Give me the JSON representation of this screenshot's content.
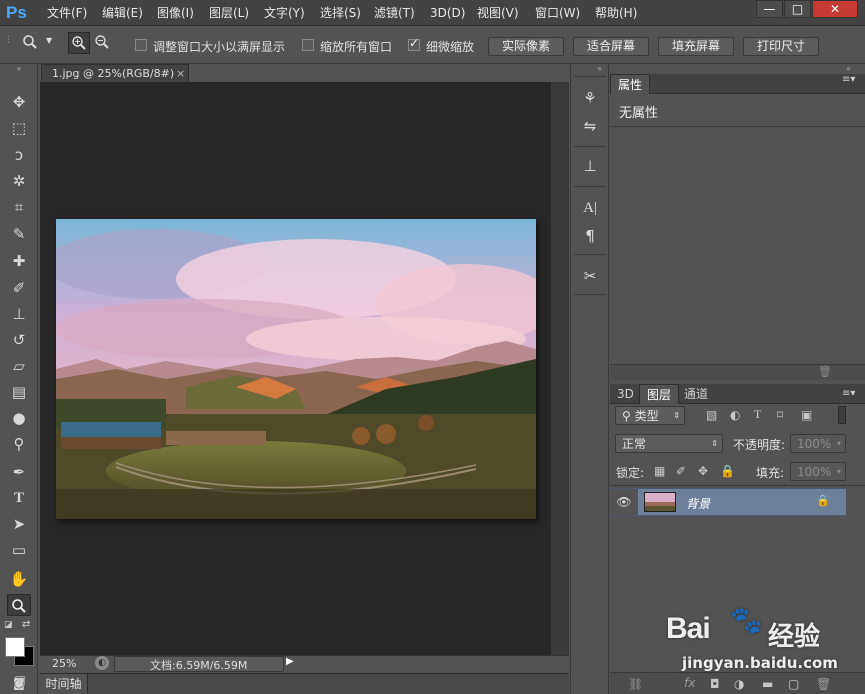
{
  "app": {
    "logo": "Ps"
  },
  "menu": [
    "文件(F)",
    "编辑(E)",
    "图像(I)",
    "图层(L)",
    "文字(Y)",
    "选择(S)",
    "滤镜(T)",
    "3D(D)",
    "视图(V)",
    "窗口(W)",
    "帮助(H)"
  ],
  "window_controls": {
    "minimize": "—",
    "restore": "□",
    "close": "✕"
  },
  "options": {
    "resize_windows_label": "调整窗口大小以满屏显示",
    "resize_windows_checked": false,
    "zoom_all_label": "缩放所有窗口",
    "zoom_all_checked": false,
    "scrubby_zoom_label": "细微缩放",
    "scrubby_zoom_checked": true,
    "actual_pixels_button": "实际像素",
    "fit_screen_button": "适合屏幕",
    "fill_screen_button": "填充屏幕",
    "print_size_button": "打印尺寸"
  },
  "document": {
    "tab_title": "1.jpg @ 25%(RGB/8#)",
    "tab_close": "×",
    "zoom": "25%",
    "doc_size": "文档:6.59M/6.59M"
  },
  "timeline": {
    "label": "时间轴"
  },
  "properties": {
    "tab": "属性",
    "content": "无属性"
  },
  "layers": {
    "tabs": [
      "3D",
      "图层",
      "通道"
    ],
    "filter_kind": "类型",
    "blend_mode": "正常",
    "opacity_label": "不透明度:",
    "opacity_value": "100%",
    "lock_label": "锁定:",
    "fill_label": "填充:",
    "fill_value": "100%",
    "rows": [
      {
        "name": "背景",
        "visible": true,
        "locked": true
      }
    ]
  },
  "watermark": {
    "brand": "Bai",
    "brand_suffix": "经验",
    "url": "jingyan.baidu.com"
  },
  "colors": {
    "accent": "#4aa8ff",
    "selected_layer": "#6d7f99"
  }
}
